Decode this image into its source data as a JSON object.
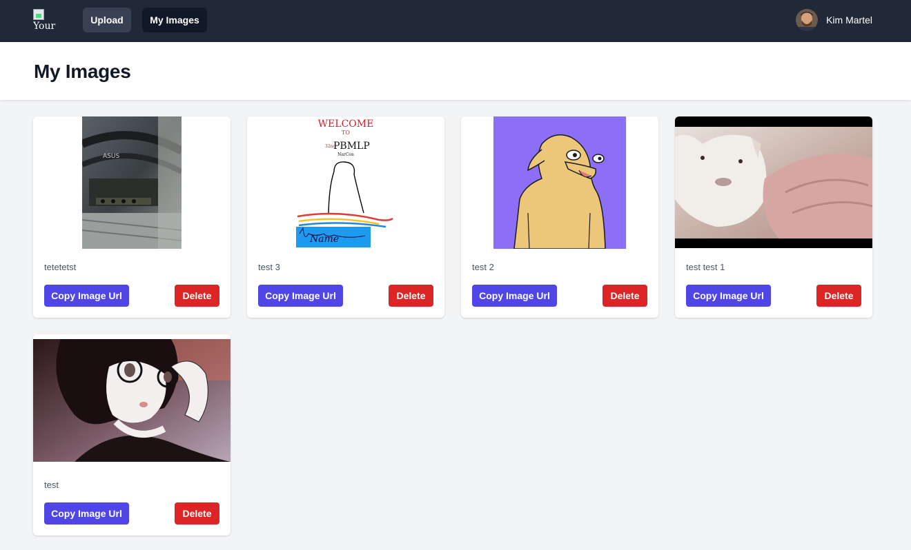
{
  "nav": {
    "logo_alt": "Your",
    "upload_label": "Upload",
    "my_images_label": "My Images",
    "user_name": "Kim Martel"
  },
  "header": {
    "title": "My Images"
  },
  "cards": [
    {
      "title": "tetetetst",
      "copy_label": "Copy Image Url",
      "delete_label": "Delete"
    },
    {
      "title": "test 3",
      "copy_label": "Copy Image Url",
      "delete_label": "Delete"
    },
    {
      "title": "test 2",
      "copy_label": "Copy Image Url",
      "delete_label": "Delete"
    },
    {
      "title": "test test 1",
      "copy_label": "Copy Image Url",
      "delete_label": "Delete"
    },
    {
      "title": "test",
      "copy_label": "Copy Image Url",
      "delete_label": "Delete"
    }
  ],
  "welcome_image": {
    "line1": "WELCOME",
    "line2": "TO",
    "line3_sup": "32nd",
    "line3": "PBMLP",
    "line4": "NarCon",
    "signature": "Name"
  },
  "colors": {
    "nav_bg": "#1f2937",
    "primary": "#4f46e5",
    "danger": "#dc2626",
    "page_bg": "#f3f4f6"
  }
}
